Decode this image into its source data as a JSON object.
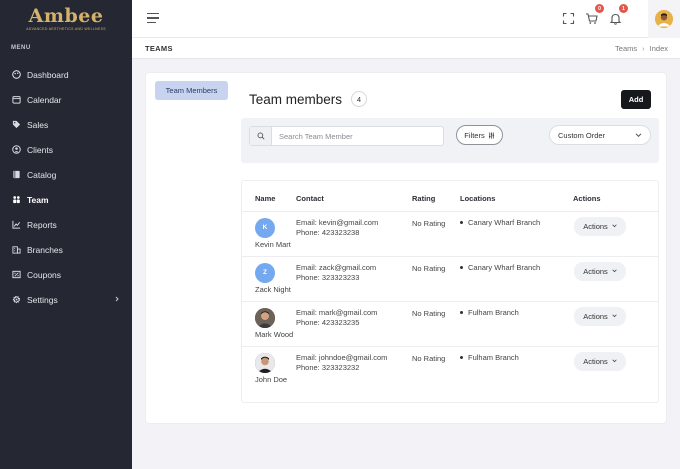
{
  "brand": {
    "name": "Ambee",
    "tagline": "ADVANCED AESTHETICS AND WELLNESS"
  },
  "sidebar": {
    "heading": "MENU",
    "items": [
      {
        "label": "Dashboard",
        "icon": "palette-icon"
      },
      {
        "label": "Calendar",
        "icon": "calendar-icon"
      },
      {
        "label": "Sales",
        "icon": "tag-icon"
      },
      {
        "label": "Clients",
        "icon": "user-circle-icon"
      },
      {
        "label": "Catalog",
        "icon": "book-icon"
      },
      {
        "label": "Team",
        "icon": "team-icon",
        "active": true
      },
      {
        "label": "Reports",
        "icon": "chart-icon"
      },
      {
        "label": "Branches",
        "icon": "building-icon"
      },
      {
        "label": "Coupons",
        "icon": "coupon-icon"
      },
      {
        "label": "Settings",
        "icon": "gear-icon",
        "expandable": true
      }
    ]
  },
  "topbar": {
    "cart_count": "0",
    "notification_count": "1"
  },
  "page": {
    "title": "TEAMS",
    "breadcrumb": [
      "Teams",
      "Index"
    ]
  },
  "content": {
    "left_tab": "Team Members",
    "section_title": "Team members",
    "member_count": "4",
    "add_label": "Add",
    "search_placeholder": "Search Team Member",
    "filters_label": "Filters",
    "order_label": "Custom Order",
    "columns": [
      "Name",
      "Contact",
      "Rating",
      "Locations",
      "Actions"
    ],
    "rows": [
      {
        "initial": "K",
        "name": "Kevin Mart",
        "email": "Email: kevin@gmail.com",
        "phone": "Phone: 423323238",
        "rating": "No Rating",
        "location": "Canary Wharf Branch",
        "action": "Actions"
      },
      {
        "initial": "Z",
        "name": "Zack Night",
        "email": "Email: zack@gmail.com",
        "phone": "Phone: 323323233",
        "rating": "No Rating",
        "location": "Canary Wharf Branch",
        "action": "Actions"
      },
      {
        "initial": "",
        "name": "Mark Wood",
        "email": "Email: mark@gmail.com",
        "phone": "Phone: 423323235",
        "rating": "No Rating",
        "location": "Fulham Branch",
        "action": "Actions"
      },
      {
        "initial": "",
        "name": "John Doe",
        "email": "Email: johndoe@gmail.com",
        "phone": "Phone: 323323232",
        "rating": "No Rating",
        "location": "Fulham Branch",
        "action": "Actions"
      }
    ]
  },
  "colors": {
    "sidebar_bg": "#252833",
    "brand_gold": "#d4b26a",
    "accent_tab": "#c8d3ef",
    "badge_red": "#e2574c",
    "avatar_blue": "#74a9f0"
  }
}
